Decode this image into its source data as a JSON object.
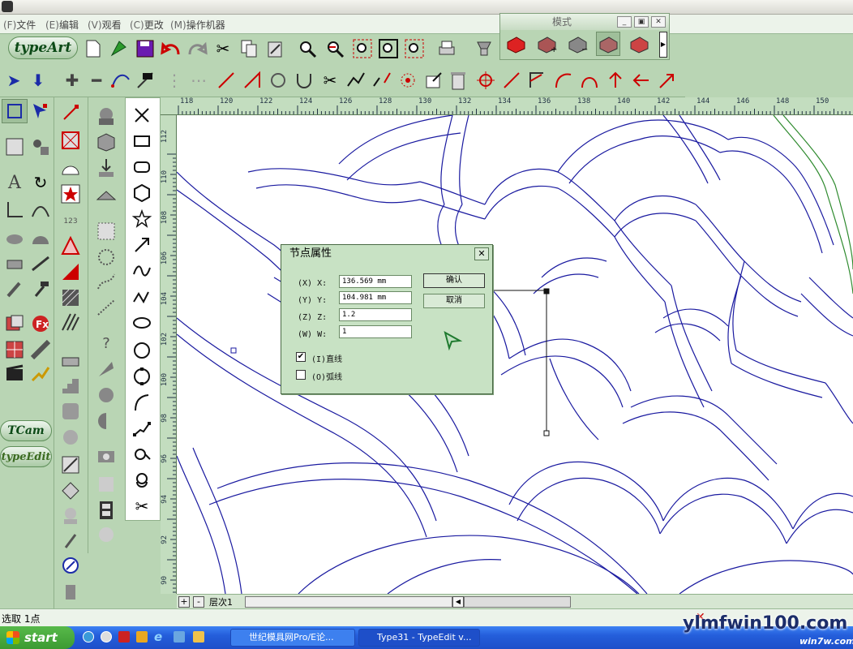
{
  "menu": {
    "items": [
      {
        "accel": "(F)",
        "label": "文件"
      },
      {
        "accel": "(E)",
        "label": "编辑"
      },
      {
        "accel": "(V)",
        "label": "观看"
      },
      {
        "accel": "(C)",
        "label": "更改"
      },
      {
        "accel": "(M)",
        "label": "操作机器"
      }
    ]
  },
  "logos": {
    "typeart": "typeArt",
    "tcam": "TCam",
    "typeedit": "typeEdit"
  },
  "float_panel": {
    "title": "模式"
  },
  "ruler": {
    "h_ticks": [
      "118",
      "120",
      "122",
      "124",
      "126",
      "128",
      "130",
      "132",
      "134",
      "136",
      "138",
      "140",
      "142",
      "144",
      "146",
      "148",
      "150"
    ],
    "v_ticks": [
      "112",
      "110",
      "108",
      "106",
      "104",
      "102",
      "100",
      "98",
      "96",
      "94",
      "92",
      "90"
    ]
  },
  "dialog": {
    "title": "节点属性",
    "close": "✕",
    "fields": [
      {
        "accel": "(X)",
        "label": "X:",
        "value": "136.569 mm"
      },
      {
        "accel": "(Y)",
        "label": "Y:",
        "value": "104.981 mm"
      },
      {
        "accel": "(Z)",
        "label": "Z:",
        "value": "1.2"
      },
      {
        "accel": "(W)",
        "label": "W:",
        "value": "1"
      }
    ],
    "ok": "确认",
    "cancel": "取消",
    "options": [
      {
        "accel": "(I)",
        "label": "直线",
        "checked": true
      },
      {
        "accel": "(O)",
        "label": "弧线",
        "checked": false
      }
    ]
  },
  "bottom_bar": {
    "plus": "+",
    "minus": "-",
    "layer": "层次1"
  },
  "status": {
    "text": "选取 1点"
  },
  "taskbar": {
    "start": "start",
    "items": [
      {
        "label": "世纪模具网Pro/E论..."
      },
      {
        "label": "Type31 - TypeEdit  v..."
      }
    ]
  },
  "watermark": {
    "main": "ylmfwin100.com",
    "sub": "win7w.com"
  },
  "colors": {
    "panel": "#b9d5b4",
    "canvas": "#ffffff",
    "vector": "#1a1aa0",
    "taskbar": "#245edb"
  }
}
